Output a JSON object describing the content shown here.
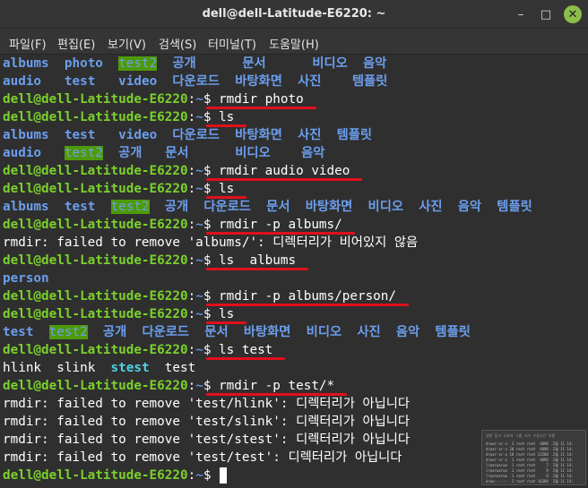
{
  "window": {
    "title": "dell@dell-Latitude-E6220: ~",
    "minimize_glyph": "–",
    "maximize_glyph": "□",
    "close_glyph": "✕"
  },
  "menu": [
    "파일(F)",
    "편집(E)",
    "보기(V)",
    "검색(S)",
    "터미널(T)",
    "도움말(H)"
  ],
  "prompt": {
    "user": "dell@dell-Latitude-E6220",
    "sep": ":",
    "path": "~",
    "symbol": "$"
  },
  "lines": [
    {
      "type": "output",
      "segments": [
        {
          "t": "albums",
          "c": "dir"
        },
        {
          "t": "  ",
          "c": "plain"
        },
        {
          "t": "photo",
          "c": "dir"
        },
        {
          "t": "  ",
          "c": "plain"
        },
        {
          "t": "test2",
          "c": "sticky"
        },
        {
          "t": "  ",
          "c": "plain"
        },
        {
          "t": "공개",
          "c": "dir"
        },
        {
          "t": "      ",
          "c": "plain"
        },
        {
          "t": "문서",
          "c": "dir"
        },
        {
          "t": "      ",
          "c": "plain"
        },
        {
          "t": "비디오",
          "c": "dir"
        },
        {
          "t": "  ",
          "c": "plain"
        },
        {
          "t": "음악",
          "c": "dir"
        }
      ]
    },
    {
      "type": "output",
      "segments": [
        {
          "t": "audio",
          "c": "dir"
        },
        {
          "t": "   ",
          "c": "plain"
        },
        {
          "t": "test",
          "c": "dir"
        },
        {
          "t": "   ",
          "c": "plain"
        },
        {
          "t": "video",
          "c": "dir"
        },
        {
          "t": "  ",
          "c": "plain"
        },
        {
          "t": "다운로드",
          "c": "dir"
        },
        {
          "t": "  ",
          "c": "plain"
        },
        {
          "t": "바탕화면",
          "c": "dir"
        },
        {
          "t": "  ",
          "c": "plain"
        },
        {
          "t": "사진",
          "c": "dir"
        },
        {
          "t": "    ",
          "c": "plain"
        },
        {
          "t": "템플릿",
          "c": "dir"
        }
      ]
    },
    {
      "type": "prompt",
      "cmd": "rmdir photo"
    },
    {
      "type": "prompt",
      "cmd": "ls"
    },
    {
      "type": "output",
      "segments": [
        {
          "t": "albums",
          "c": "dir"
        },
        {
          "t": "  ",
          "c": "plain"
        },
        {
          "t": "test",
          "c": "dir"
        },
        {
          "t": "   ",
          "c": "plain"
        },
        {
          "t": "video",
          "c": "dir"
        },
        {
          "t": "  ",
          "c": "plain"
        },
        {
          "t": "다운로드",
          "c": "dir"
        },
        {
          "t": "  ",
          "c": "plain"
        },
        {
          "t": "바탕화면",
          "c": "dir"
        },
        {
          "t": "  ",
          "c": "plain"
        },
        {
          "t": "사진",
          "c": "dir"
        },
        {
          "t": "  ",
          "c": "plain"
        },
        {
          "t": "템플릿",
          "c": "dir"
        }
      ]
    },
    {
      "type": "output",
      "segments": [
        {
          "t": "audio",
          "c": "dir"
        },
        {
          "t": "   ",
          "c": "plain"
        },
        {
          "t": "test2",
          "c": "sticky"
        },
        {
          "t": "  ",
          "c": "plain"
        },
        {
          "t": "공개",
          "c": "dir"
        },
        {
          "t": "   ",
          "c": "plain"
        },
        {
          "t": "문서",
          "c": "dir"
        },
        {
          "t": "      ",
          "c": "plain"
        },
        {
          "t": "비디오",
          "c": "dir"
        },
        {
          "t": "    ",
          "c": "plain"
        },
        {
          "t": "음악",
          "c": "dir"
        }
      ]
    },
    {
      "type": "prompt",
      "cmd": "rmdir audio video"
    },
    {
      "type": "prompt",
      "cmd": "ls"
    },
    {
      "type": "output",
      "segments": [
        {
          "t": "albums",
          "c": "dir"
        },
        {
          "t": "  ",
          "c": "plain"
        },
        {
          "t": "test",
          "c": "dir"
        },
        {
          "t": "  ",
          "c": "plain"
        },
        {
          "t": "test2",
          "c": "sticky"
        },
        {
          "t": "  ",
          "c": "plain"
        },
        {
          "t": "공개",
          "c": "dir"
        },
        {
          "t": "  ",
          "c": "plain"
        },
        {
          "t": "다운로드",
          "c": "dir"
        },
        {
          "t": "  ",
          "c": "plain"
        },
        {
          "t": "문서",
          "c": "dir"
        },
        {
          "t": "  ",
          "c": "plain"
        },
        {
          "t": "바탕화면",
          "c": "dir"
        },
        {
          "t": "  ",
          "c": "plain"
        },
        {
          "t": "비디오",
          "c": "dir"
        },
        {
          "t": "  ",
          "c": "plain"
        },
        {
          "t": "사진",
          "c": "dir"
        },
        {
          "t": "  ",
          "c": "plain"
        },
        {
          "t": "음악",
          "c": "dir"
        },
        {
          "t": "  ",
          "c": "plain"
        },
        {
          "t": "템플릿",
          "c": "dir"
        }
      ]
    },
    {
      "type": "prompt",
      "cmd": "rmdir -p albums/"
    },
    {
      "type": "output",
      "segments": [
        {
          "t": "rmdir: failed to remove 'albums/': 디렉터리가 비어있지 않음",
          "c": "plain"
        }
      ]
    },
    {
      "type": "prompt",
      "cmd": "ls  albums"
    },
    {
      "type": "output",
      "segments": [
        {
          "t": "person",
          "c": "dir"
        }
      ]
    },
    {
      "type": "prompt",
      "cmd": "rmdir -p albums/person/"
    },
    {
      "type": "prompt",
      "cmd": "ls"
    },
    {
      "type": "output",
      "segments": [
        {
          "t": "test",
          "c": "dir"
        },
        {
          "t": "  ",
          "c": "plain"
        },
        {
          "t": "test2",
          "c": "sticky"
        },
        {
          "t": "  ",
          "c": "plain"
        },
        {
          "t": "공개",
          "c": "dir"
        },
        {
          "t": "  ",
          "c": "plain"
        },
        {
          "t": "다운로드",
          "c": "dir"
        },
        {
          "t": "  ",
          "c": "plain"
        },
        {
          "t": "문서",
          "c": "dir"
        },
        {
          "t": "  ",
          "c": "plain"
        },
        {
          "t": "바탕화면",
          "c": "dir"
        },
        {
          "t": "  ",
          "c": "plain"
        },
        {
          "t": "비디오",
          "c": "dir"
        },
        {
          "t": "  ",
          "c": "plain"
        },
        {
          "t": "사진",
          "c": "dir"
        },
        {
          "t": "  ",
          "c": "plain"
        },
        {
          "t": "음악",
          "c": "dir"
        },
        {
          "t": "  ",
          "c": "plain"
        },
        {
          "t": "템플릿",
          "c": "dir"
        }
      ]
    },
    {
      "type": "prompt",
      "cmd": "ls test"
    },
    {
      "type": "output",
      "segments": [
        {
          "t": "hlink",
          "c": "plain"
        },
        {
          "t": "  ",
          "c": "plain"
        },
        {
          "t": "slink",
          "c": "plain"
        },
        {
          "t": "  ",
          "c": "plain"
        },
        {
          "t": "stest",
          "c": "exe"
        },
        {
          "t": "  ",
          "c": "plain"
        },
        {
          "t": "test",
          "c": "plain"
        }
      ]
    },
    {
      "type": "prompt",
      "cmd": "rmdir -p test/*"
    },
    {
      "type": "output",
      "segments": [
        {
          "t": "rmdir: failed to remove 'test/hlink': 디렉터리가 아닙니다",
          "c": "plain"
        }
      ]
    },
    {
      "type": "output",
      "segments": [
        {
          "t": "rmdir: failed to remove 'test/slink': 디렉터리가 아닙니다",
          "c": "plain"
        }
      ]
    },
    {
      "type": "output",
      "segments": [
        {
          "t": "rmdir: failed to remove 'test/stest': 디렉터리가 아닙니다",
          "c": "plain"
        }
      ]
    },
    {
      "type": "output",
      "segments": [
        {
          "t": "rmdir: failed to remove 'test/test': 디렉터리가 아닙니다",
          "c": "plain"
        }
      ]
    },
    {
      "type": "prompt",
      "cmd": ""
    }
  ],
  "thumbnail": {
    "header": "권한  링크 소유자 그룹  크기 수정시간  이름",
    "rows": [
      "drwxr-xr-x  3 root root  4096  2월 11 14:",
      "drwxr-xr-x 20 root root  4096  2월 11 14:",
      "drwxr-xr-x 18 root root 12288  2월 11 14:",
      "drwxr-xr-x  1 root root  4096  2월 11 14:",
      "lrwxrwxrwx  1 root root     7  2월 11 14:",
      "lrwxrwxrwx  1 root root     9  2월 11 14:",
      "lrwxrwxrwx  1 root root     8  2월 11 14:",
      "drwx------  2 root root 16384  2월 11 14:"
    ]
  },
  "colors": {
    "background": "#2f2f2f",
    "prompt_user": "#7bd12c",
    "prompt_path": "#5e8fd8",
    "directory": "#6c9eee",
    "sticky_bg": "#4e9a06",
    "executable": "#4fd3e6",
    "annotation_underline": "#e0101c",
    "close_button": "#8cbe4a"
  }
}
